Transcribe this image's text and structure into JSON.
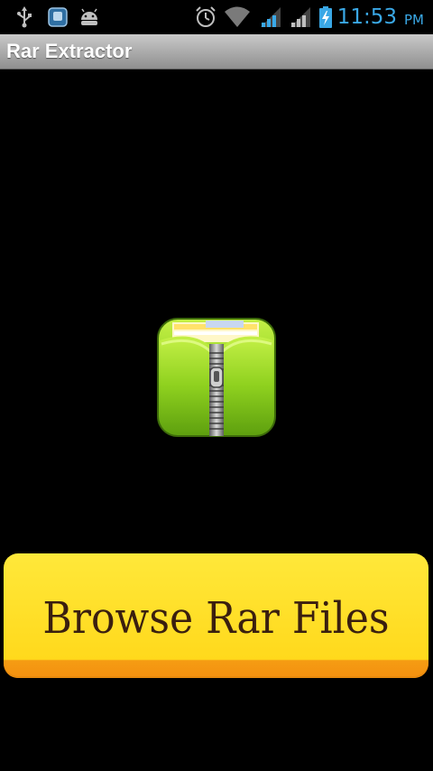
{
  "status_bar": {
    "time": "11:53",
    "ampm": "PM",
    "icons": [
      "usb-icon",
      "storage-icon",
      "android-icon",
      "alarm-icon",
      "wifi-icon",
      "signal-icon",
      "signal-icon",
      "battery-charging-icon"
    ]
  },
  "app_bar": {
    "title": "Rar Extractor"
  },
  "main": {
    "app_icon": "zip-folder-icon",
    "browse_button_label": "Browse Rar Files"
  },
  "colors": {
    "status_text": "#3aa8e6",
    "button_yellow": "#ffe01f",
    "button_bottom": "#f4900f",
    "button_text": "#3a1f0f",
    "icon_green": "#8fd11f"
  }
}
